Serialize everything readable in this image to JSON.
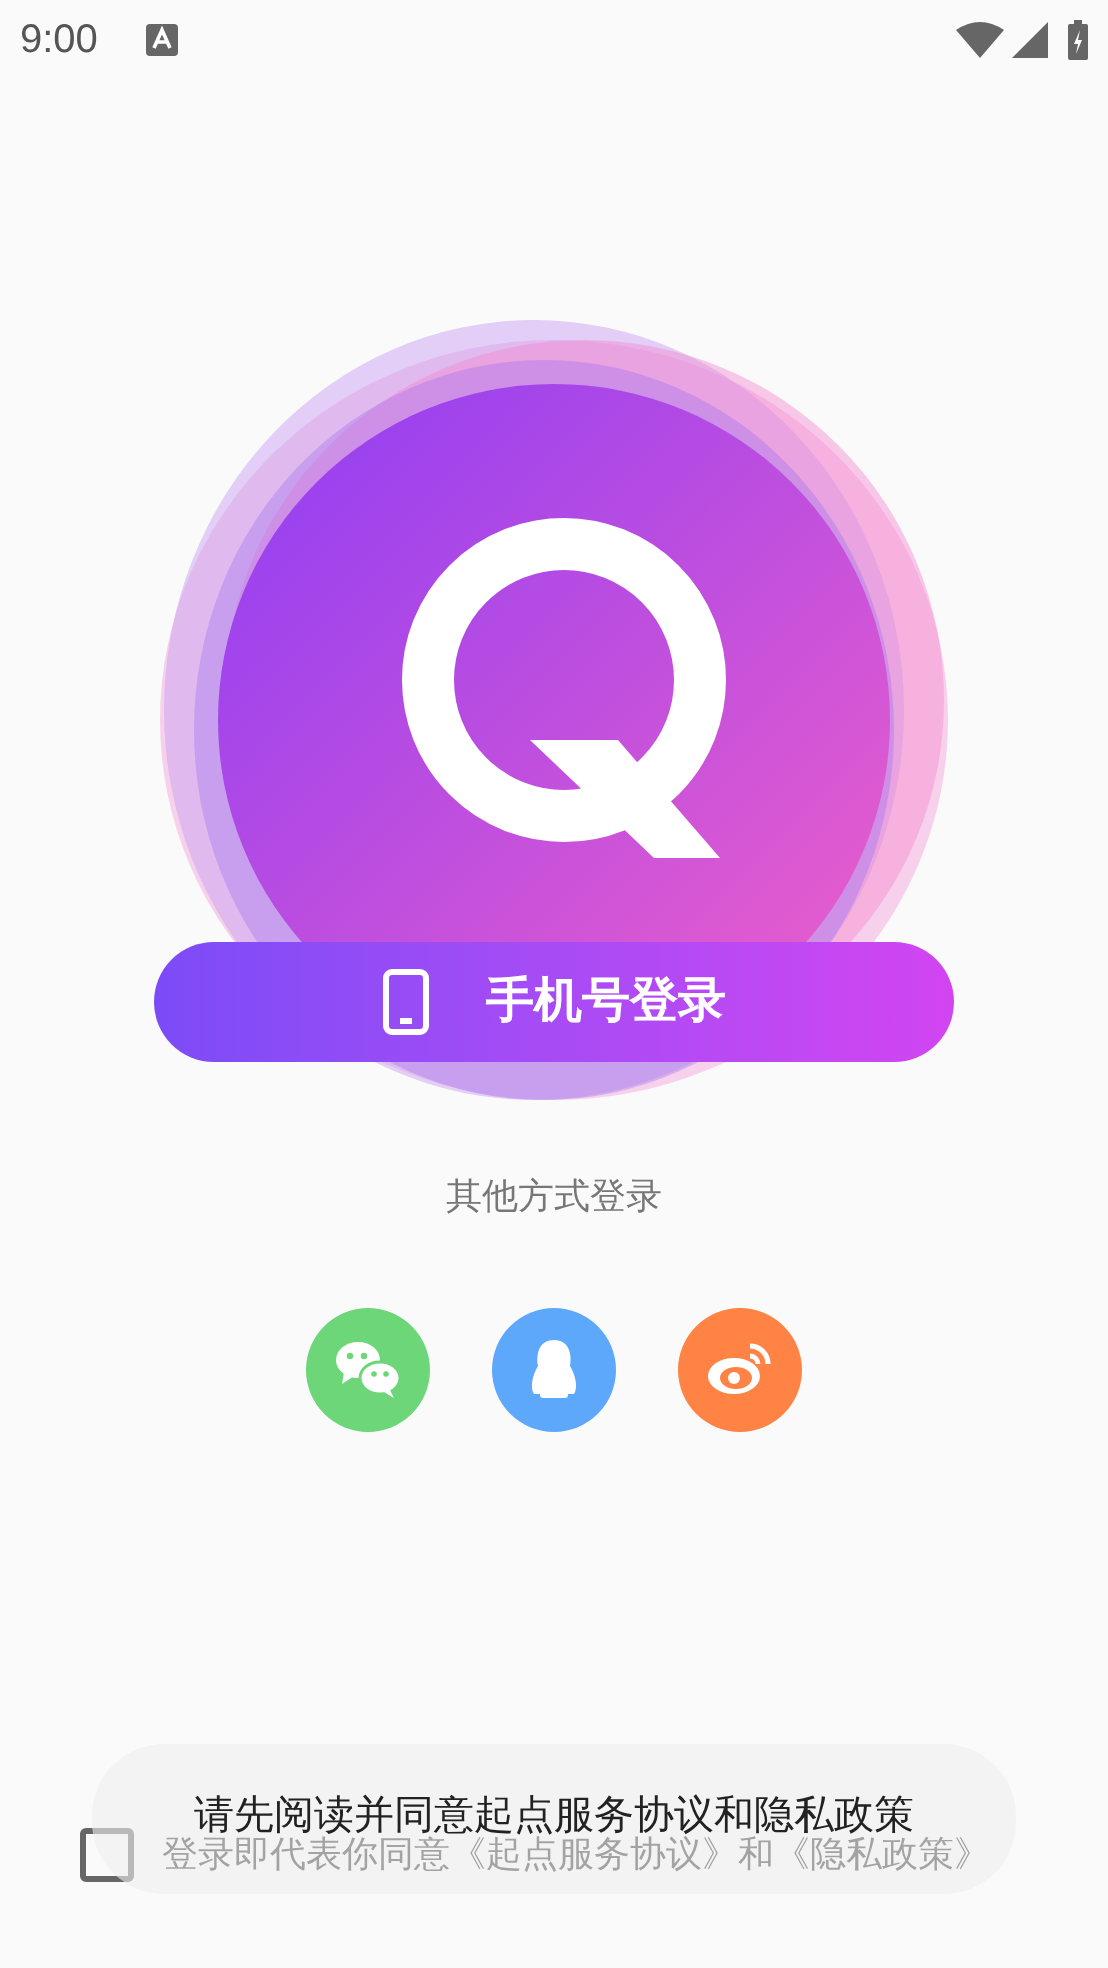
{
  "status_bar": {
    "time": "9:00"
  },
  "login_button": {
    "label": "手机号登录"
  },
  "other_login_label": "其他方式登录",
  "social_buttons": [
    {
      "kind": "chat",
      "color": "#6cd679"
    },
    {
      "kind": "penguin",
      "color": "#5ea8fb"
    },
    {
      "kind": "eye",
      "color": "#fe8344"
    }
  ],
  "agreement": {
    "checked": false,
    "text": "登录即代表你同意《起点服务协议》和《隐私政策》"
  },
  "toast": {
    "text": "请先阅读并同意起点服务协议和隐私政策"
  }
}
